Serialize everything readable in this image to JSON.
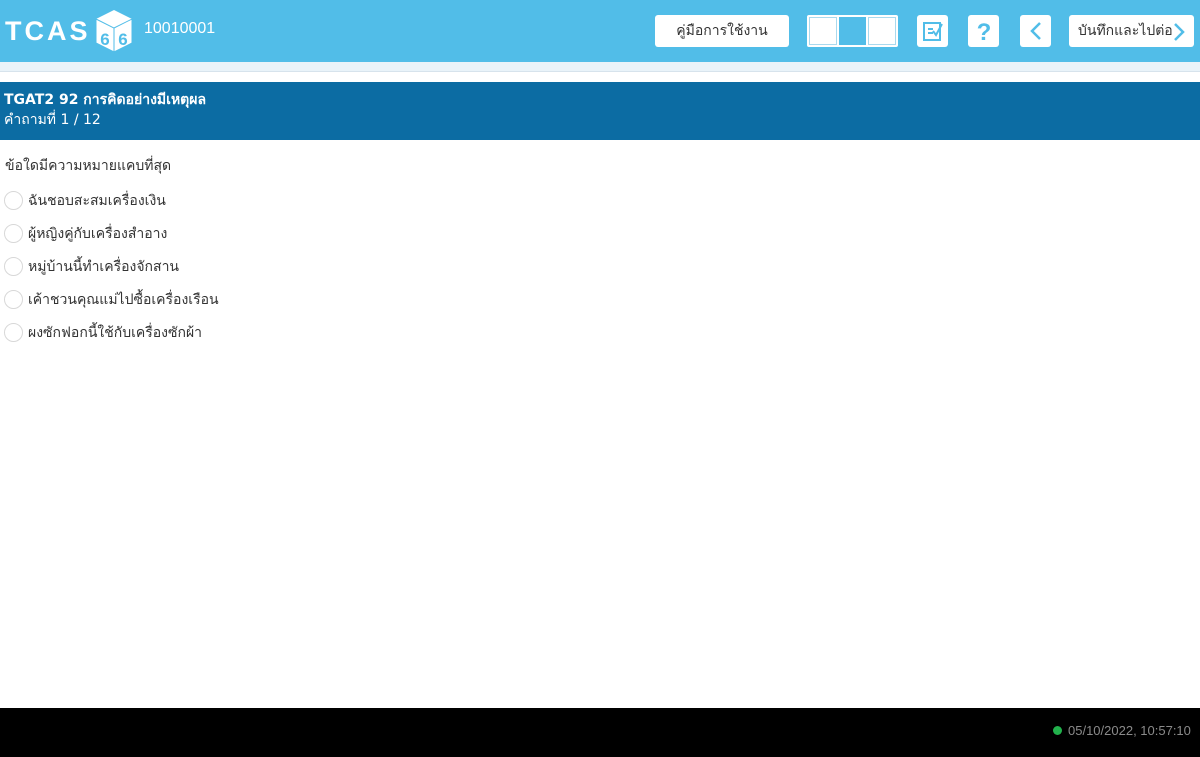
{
  "header": {
    "logo_text": "TCAS",
    "logo_digits": [
      "6",
      "6"
    ],
    "exam_id": "10010001",
    "manual_label": "คู่มือการใช้งาน",
    "layout_options": [
      "layout-1",
      "layout-2",
      "layout-3"
    ],
    "selected_layout_index": 1,
    "save_next_label": "บันทึกและไปต่อ",
    "icons": [
      "checklist-icon",
      "help-icon",
      "back-icon",
      "chevron-right-icon"
    ]
  },
  "subject": {
    "title": "TGAT2 92 การคิดอย่างมีเหตุผล",
    "counter": "คำถามที่ 1 / 12"
  },
  "question": {
    "text": "ข้อใดมีความหมายแคบที่สุด",
    "choices": [
      "ฉันชอบสะสมเครื่องเงิน",
      "ผู้หญิงคู่กับเครื่องสำอาง",
      "หมู่บ้านนี้ทำเครื่องจักสาน",
      "เค้าชวนคุณแม่ไปซื้อเครื่องเรือน",
      "ผงซักฟอกนี้ใช้กับเครื่องซักผ้า"
    ]
  },
  "status": {
    "connection_color": "#22b14c",
    "datetime": "05/10/2022, 10:57:10"
  },
  "colors": {
    "topbar": "#51bde8",
    "subject_bar": "#0c6ca3",
    "status_bar": "#000000"
  }
}
